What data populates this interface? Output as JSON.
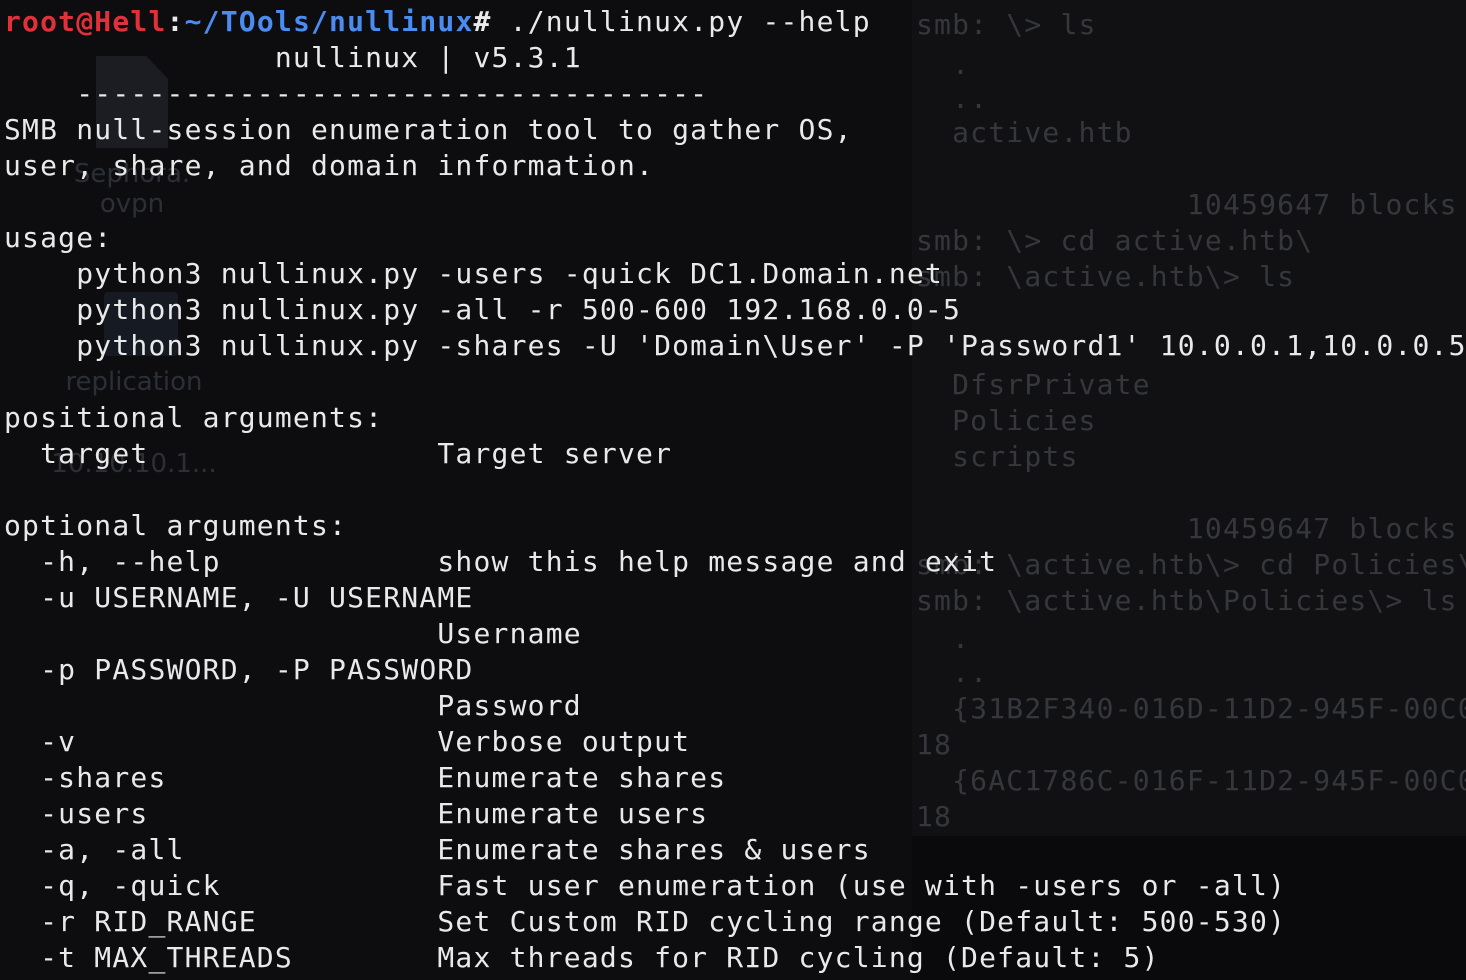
{
  "desktop": {
    "icons": [
      {
        "label": "Sephora.\novpn"
      },
      {
        "label": "replication"
      },
      {
        "label": "10.10.10.1..."
      }
    ]
  },
  "background_terminal": {
    "lines": [
      "smb: \\> ls",
      "  .",
      "  ..",
      "  active.htb",
      "               10459647 blocks",
      "smb: \\> cd active.htb\\",
      "smb: \\active.htb\\> ls",
      "  DfsrPrivate",
      "  Policies",
      "  scripts",
      "               10459647 blocks",
      "smb: \\active.htb\\> cd Policies\\",
      "smb: \\active.htb\\Policies\\> ls",
      "  .",
      "  ..",
      "  {31B2F340-016D-11D2-945F-00C0",
      "18",
      "  {6AC1786C-016F-11D2-945F-00C0",
      "18"
    ]
  },
  "terminal": {
    "prompt": {
      "user": "root@Hell",
      "sep": ":",
      "path": "~/TOols/nullinux",
      "symbol": "# ",
      "command": "./nullinux.py --help"
    },
    "lines": [
      "               nullinux | v5.3.1",
      "    -----------------------------------",
      "SMB null-session enumeration tool to gather OS,",
      "user, share, and domain information.",
      "",
      "usage:",
      "    python3 nullinux.py -users -quick DC1.Domain.net",
      "    python3 nullinux.py -all -r 500-600 192.168.0.0-5",
      "    python3 nullinux.py -shares -U 'Domain\\User' -P 'Password1' 10.0.0.1,10.0.0.5",
      "",
      "positional arguments:",
      "  target                Target server",
      "",
      "optional arguments:",
      "  -h, --help            show this help message and exit",
      "  -u USERNAME, -U USERNAME",
      "                        Username",
      "  -p PASSWORD, -P PASSWORD",
      "                        Password",
      "  -v                    Verbose output",
      "  -shares               Enumerate shares",
      "  -users                Enumerate users",
      "  -a, -all              Enumerate shares & users",
      "  -q, -quick            Fast user enumeration (use with -users or -all)",
      "  -r RID_RANGE          Set Custom RID cycling range (Default: 500-530)",
      "  -t MAX_THREADS        Max threads for RID cycling (Default: 5)"
    ]
  }
}
